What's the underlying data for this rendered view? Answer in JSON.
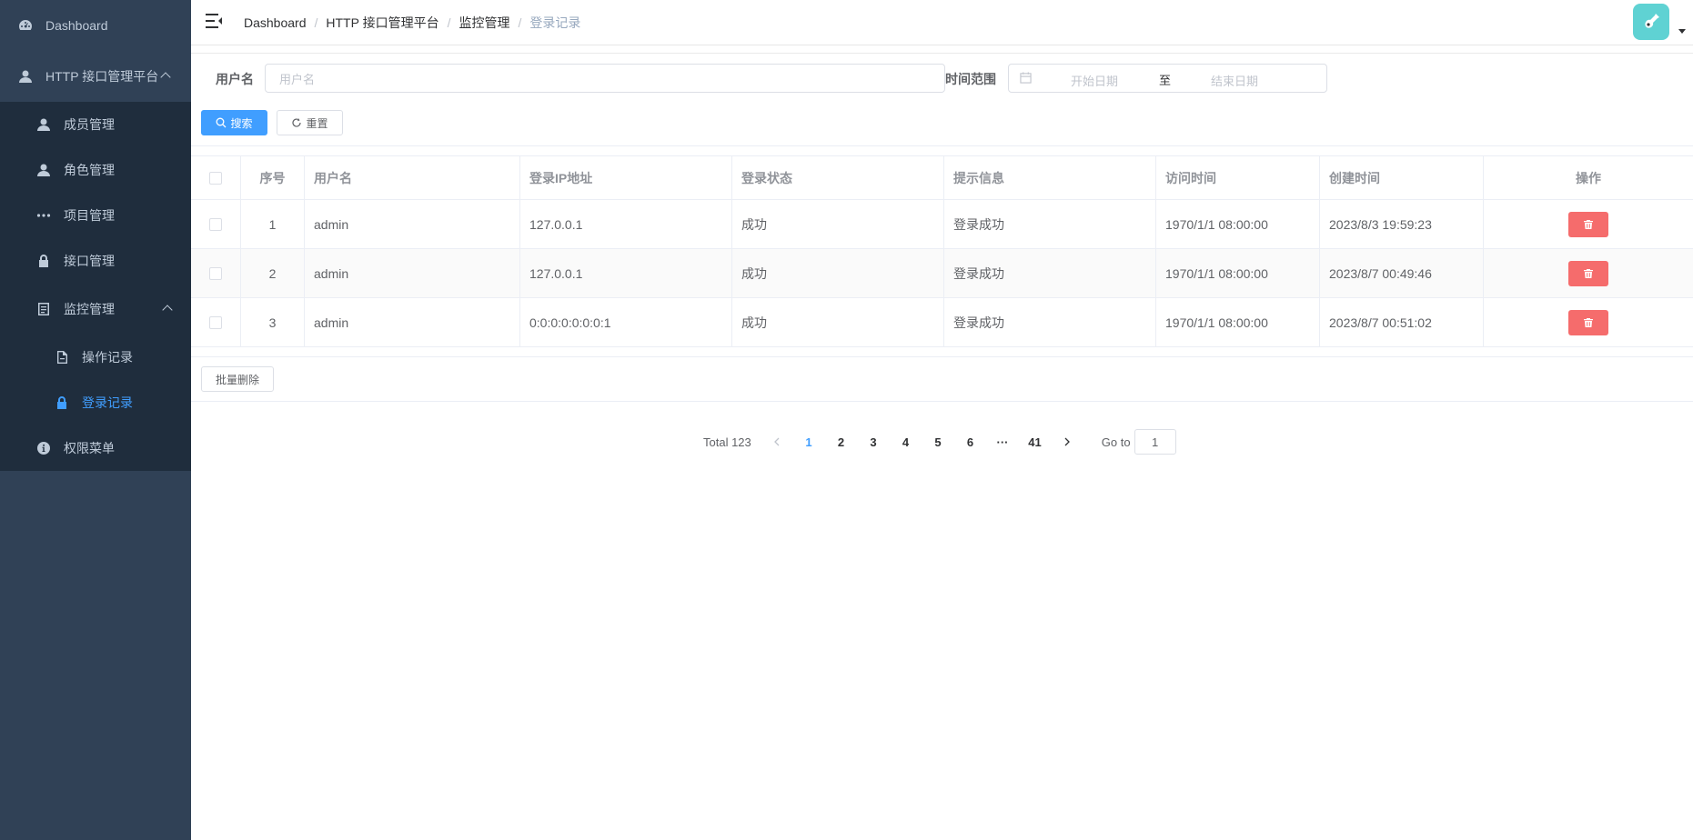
{
  "sidebar": {
    "dashboard": "Dashboard",
    "platform": "HTTP 接口管理平台",
    "members": "成员管理",
    "roles": "角色管理",
    "projects": "项目管理",
    "apis": "接口管理",
    "monitor": "监控管理",
    "op_logs": "操作记录",
    "login_logs": "登录记录",
    "permissions": "权限菜单"
  },
  "breadcrumb": [
    "Dashboard",
    "HTTP 接口管理平台",
    "监控管理",
    "登录记录"
  ],
  "search": {
    "username_label": "用户名",
    "username_placeholder": "用户名",
    "range_label": "时间范围",
    "start_placeholder": "开始日期",
    "range_sep": "至",
    "end_placeholder": "结束日期",
    "search_btn": "搜索",
    "reset_btn": "重置"
  },
  "table": {
    "headers": [
      "序号",
      "用户名",
      "登录IP地址",
      "登录状态",
      "提示信息",
      "访问时间",
      "创建时间",
      "操作"
    ],
    "rows": [
      {
        "index": "1",
        "username": "admin",
        "ip": "127.0.0.1",
        "status": "成功",
        "message": "登录成功",
        "visit_time": "1970/1/1 08:00:00",
        "created_time": "2023/8/3 19:59:23"
      },
      {
        "index": "2",
        "username": "admin",
        "ip": "127.0.0.1",
        "status": "成功",
        "message": "登录成功",
        "visit_time": "1970/1/1 08:00:00",
        "created_time": "2023/8/7 00:49:46"
      },
      {
        "index": "3",
        "username": "admin",
        "ip": "0:0:0:0:0:0:0:1",
        "status": "成功",
        "message": "登录成功",
        "visit_time": "1970/1/1 08:00:00",
        "created_time": "2023/8/7 00:51:02"
      }
    ]
  },
  "batch_delete": "批量删除",
  "pagination": {
    "total": "Total 123",
    "pages": [
      "1",
      "2",
      "3",
      "4",
      "5",
      "6"
    ],
    "ellipsis": "···",
    "last_page": "41",
    "current": "1",
    "goto_label": "Go to",
    "goto_value": "1"
  },
  "colors": {
    "sidebar_bg": "#304156",
    "submenu_bg": "#1f2d3d",
    "accent": "#409eff",
    "danger": "#f56c6c",
    "avatar_bg": "#5fd2d3"
  }
}
